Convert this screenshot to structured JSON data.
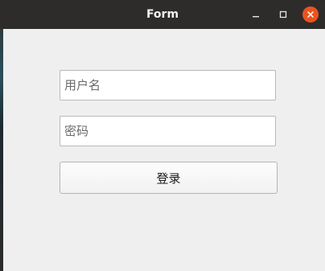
{
  "window": {
    "title": "Form",
    "buttons": {
      "minimize_icon": "minimize-icon",
      "maximize_icon": "maximize-icon",
      "close_icon": "close-icon"
    },
    "accent_color": "#e95420"
  },
  "form": {
    "username": {
      "value": "",
      "placeholder": "用户名"
    },
    "password": {
      "value": "",
      "placeholder": "密码"
    },
    "login_label": "登录"
  }
}
